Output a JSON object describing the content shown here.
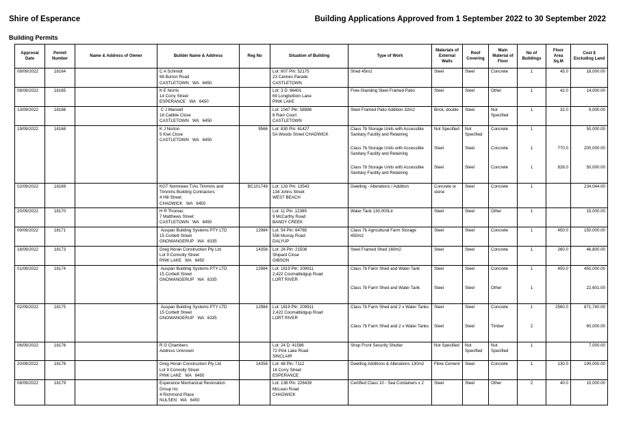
{
  "header": {
    "shire": "Shire of Esperance",
    "title": "Building Applications Approved from 1 September 2022 to 30 September 2022",
    "subtitle": "Building Permits"
  },
  "columns": [
    "Approval Date",
    "Permit Number",
    "Name & Address of Owner",
    "Builder Name & Address",
    "Reg No",
    "Situation of Building",
    "Type of Work",
    "Materials of External Walls",
    "Roof Covering",
    "Main Material of Floor",
    "No of Buildings",
    "Floor Area Sq.M",
    "Cost $ Excluding Land"
  ],
  "rows": [
    {
      "date": "08/09/2022",
      "permit": "18164",
      "owner": "",
      "builder": [
        "C A Schmidt",
        "68 Burton Road",
        "CASTLETOWN   WA   6450"
      ],
      "reg": "",
      "situation": [
        "Lot: 807 Pln: 52175",
        "23 Cannes Parade",
        "CASTLETOWN"
      ],
      "works": [
        {
          "type": [
            "Shed 45m2"
          ],
          "walls": "Steel",
          "roof": "Steel",
          "floor": "Concrete",
          "num": "1",
          "area": "45.0",
          "cost": "18,000.00"
        }
      ]
    },
    {
      "date": "08/09/2022",
      "permit": "18165",
      "owner": "",
      "builder": [
        "K E Norris",
        "14 Corry Street",
        "ESPERANCE   WA   6450"
      ],
      "reg": "",
      "situation": [
        "Lot: 3 D: 66401",
        "69 Longbottom Lane",
        "PINK LAKE"
      ],
      "works": [
        {
          "type": [
            "Free-Standing Steel Framed Patio"
          ],
          "walls": "Steel",
          "roof": "Steel",
          "floor": "Other",
          "num": "1",
          "area": "42.0",
          "cost": "14,000.00"
        }
      ]
    },
    {
      "date": "13/09/2022",
      "permit": "18166",
      "owner": "",
      "builder": [
        " C J Mansell",
        "16 Cabble Close",
        "CASTLETOWN   WA   6450"
      ],
      "reg": "",
      "situation": [
        "Lot: 1047 Pln: 58988",
        "8 Ram Court",
        "CASTLETOWN"
      ],
      "works": [
        {
          "type": [
            "Steel Framed Patio Addition 32m2"
          ],
          "walls": "Brick, double",
          "roof": "Steel",
          "floor": "Not Specified",
          "num": "1",
          "area": "32.0",
          "cost": "9,000.00"
        }
      ]
    },
    {
      "date": "19/09/2022",
      "permit": "18168",
      "owner": "",
      "builder": [
        "K J Norton",
        "5 Kiwi Close",
        "CASTLETOWN   WA   6450"
      ],
      "reg": "9566",
      "situation": [
        "Lot: 830 Pln: 61427",
        "5A Woods Street CHADWICK"
      ],
      "works": [
        {
          "type": [
            "Class 7b Storage Units with Accessible Sanitary Facility and Retaining"
          ],
          "walls": "Not Specified",
          "roof": "Not Specified",
          "floor": "Concrete",
          "num": "1",
          "area": "",
          "cost": "50,000.00"
        },
        {
          "type": [
            "Class 7b Storage Units with Accessible Sanitary Facility and Retaining"
          ],
          "walls": "Steel",
          "roof": "Steel",
          "floor": "Concrete",
          "num": "1",
          "area": "770.0",
          "cost": "200,000.00"
        },
        {
          "type": [
            "Class 7b Storage Units with Accessible Sanitary Facility and Retaining"
          ],
          "walls": "Steel",
          "roof": "Steel",
          "floor": "Concrete",
          "num": "1",
          "area": "828.0",
          "cost": "50,000.00"
        }
      ]
    },
    {
      "date": "02/09/2022",
      "permit": "18169",
      "owner": "",
      "builder": [
        "KGT Nominees T/As Timmins and Timmins Building Contractors",
        "4 Hill Street",
        "CHADWICK   WA   6450"
      ],
      "reg": "BC101749",
      "situation": [
        "Lot: 133 Pln: 13543",
        "134 Johns Street",
        "WEST BEACH"
      ],
      "works": [
        {
          "type": [
            "Dwelling - Alterations / Addition"
          ],
          "walls": "Concrete or stone",
          "roof": "Steel",
          "floor": "Concrete",
          "num": "1",
          "area": "",
          "cost": "234,044.00"
        }
      ]
    },
    {
      "date": "20/09/2022",
      "permit": "18170",
      "owner": "",
      "builder": [
        "H R Thomas",
        "7 Matthews Street",
        "CASTLETOWN   WA   6450"
      ],
      "reg": "",
      "situation": [
        "Lot: 11 Pln: 12389",
        "9 McCarthy Road",
        "BANDY CREEK"
      ],
      "works": [
        {
          "type": [
            "Water Tank 130,000Ltr"
          ],
          "walls": "Steel",
          "roof": "Steel",
          "floor": "Other",
          "num": "1",
          "area": "",
          "cost": "15,000.00"
        }
      ]
    },
    {
      "date": "09/09/2022",
      "permit": "18171",
      "owner": "",
      "builder": [
        " Auspan Building Systems PTY LTD",
        "15 Corbett Street",
        "GNOWANGERUP   WA   6335"
      ],
      "reg": "12984",
      "situation": [
        "Lot: 54 Pln: 64765",
        "556 Murray Road",
        "DALYUP"
      ],
      "works": [
        {
          "type": [
            "Class 7b Agricultural Farm Storage 450m2"
          ],
          "walls": "Steel",
          "roof": "Steel",
          "floor": "Concrete",
          "num": "1",
          "area": "450.0",
          "cost": "150,000.00"
        }
      ]
    },
    {
      "date": "16/09/2022",
      "permit": "18173",
      "owner": "",
      "builder": [
        "Greg Horan Construction Pty Ltd",
        "Lot 9 Connolly Street",
        "PINK LAKE   WA   6450"
      ],
      "reg": "14356",
      "situation": [
        "Lot: 26 Pln: 21508",
        "Shipard Close",
        "GIBSON"
      ],
      "works": [
        {
          "type": [
            "Steel Framed Shed 160m2"
          ],
          "walls": "Steel",
          "roof": "Steel",
          "floor": "Concrete",
          "num": "1",
          "area": "260.0",
          "cost": "46,800.00"
        }
      ]
    },
    {
      "date": "01/09/2022",
      "permit": "18174",
      "owner": "",
      "builder": [
        " Auspan Building Systems PTY LTD",
        "15 Corbett Street",
        "GNOWANGERUP   WA   6335"
      ],
      "reg": "12984",
      "situation": [
        "Lot: 1819 Pln: 209911",
        "2,422 Coomalbidgup Road",
        "LORT RIVER"
      ],
      "works": [
        {
          "type": [
            "Class 7b Farm Shed and Water Tank"
          ],
          "walls": "Steel",
          "roof": "Steel",
          "floor": "Concrete",
          "num": "1",
          "area": "450.0",
          "cost": "450,000.00"
        },
        {
          "type": [
            "Class 7b Farm Shed and Water Tank"
          ],
          "walls": "Steel",
          "roof": "Steel",
          "floor": "Other",
          "num": "1",
          "area": "",
          "cost": "22,601.00"
        }
      ]
    },
    {
      "date": "02/09/2022",
      "permit": "18175",
      "owner": "",
      "builder": [
        " Auspan Building Systems PTY LTD",
        "15 Corbett Street",
        "GNOWANGERUP   WA   6335"
      ],
      "reg": "12984",
      "situation": [
        "Lot: 1819 Pln: 209911",
        "2,422 Coomalbidgup Road",
        "LORT RIVER"
      ],
      "works": [
        {
          "type": [
            "Class 7b Farm Shed and 2 x Water Tanks"
          ],
          "walls": "Steel",
          "roof": "Steel",
          "floor": "Concrete",
          "num": "1",
          "area": "2560.0",
          "cost": "871,740.00"
        },
        {
          "type": [
            "Class 7b Farm Shed and 2 x Water Tanks"
          ],
          "walls": "Steel",
          "roof": "Steel",
          "floor": "Timber",
          "num": "2",
          "area": "",
          "cost": "60,000.00"
        }
      ]
    },
    {
      "date": "06/09/2022",
      "permit": "18176",
      "owner": "",
      "builder": [
        "R G Chambers",
        "Address Unknown"
      ],
      "reg": "",
      "situation": [
        "Lot: 24 D: 41586",
        "72 Pink Lake Road",
        "SINCLAIR"
      ],
      "works": [
        {
          "type": [
            "Shop Front Security Shutter"
          ],
          "walls": "Not Specified",
          "roof": "Not Specified",
          "floor": "Not Specified",
          "num": "1",
          "area": "",
          "cost": "7,000.00"
        }
      ]
    },
    {
      "date": "20/09/2022",
      "permit": "18178",
      "owner": "",
      "builder": [
        "Greg Horan Construction Pty Ltd",
        "Lot 9 Connolly Street",
        "PINK LAKE   WA   6450"
      ],
      "reg": "14356",
      "situation": [
        "Lot: 48 Pln: 7112",
        "16 Corry Street",
        "ESPERANCE"
      ],
      "works": [
        {
          "type": [
            "Dwelling Additions & Alterations 130m2"
          ],
          "walls": "Fibre Cement",
          "roof": "Steel",
          "floor": "Concrete",
          "num": "1",
          "area": "130.0",
          "cost": "190,000.00"
        }
      ]
    },
    {
      "date": "08/09/2022",
      "permit": "18179",
      "owner": "",
      "builder": [
        "Esperance Mechanical Restoration Group Inc",
        "4 Richmond Place",
        "NULSEN   WA   6450"
      ],
      "reg": "",
      "situation": [
        "Lot: 138 Pln: 226439",
        "McLean Road",
        "CHADWICK"
      ],
      "works": [
        {
          "type": [
            "Certified Class 10 - Sea Containers x 2"
          ],
          "walls": "Steel",
          "roof": "Steel",
          "floor": "Other",
          "num": "2",
          "area": "40.0",
          "cost": "10,000.00"
        }
      ]
    }
  ]
}
